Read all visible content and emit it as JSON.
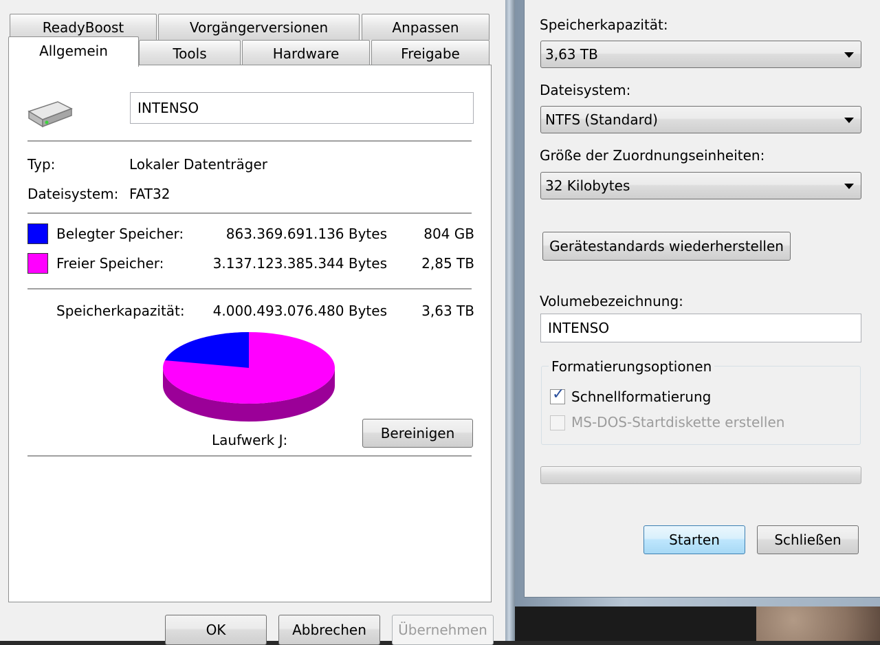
{
  "properties": {
    "tabs_row1": [
      "ReadyBoost",
      "Vorgängerversionen",
      "Anpassen"
    ],
    "tabs_row2": [
      "Allgemein",
      "Tools",
      "Hardware",
      "Freigabe"
    ],
    "active_tab": "Allgemein",
    "drive_icon": "hard-drive-icon",
    "volume_name": "INTENSO",
    "type_label": "Typ:",
    "type_value": "Lokaler Datenträger",
    "filesystem_label": "Dateisystem:",
    "filesystem_value": "FAT32",
    "used": {
      "label": "Belegter Speicher:",
      "bytes": "863.369.691.136 Bytes",
      "size": "804 GB",
      "color": "#0000ff"
    },
    "free": {
      "label": "Freier Speicher:",
      "bytes": "3.137.123.385.344 Bytes",
      "size": "2,85 TB",
      "color": "#ff00ff"
    },
    "capacity": {
      "label": "Speicherkapazität:",
      "bytes": "4.000.493.076.480 Bytes",
      "size": "3,63 TB"
    },
    "pie": {
      "used_fraction": 0.216,
      "used_color": "#0000ff",
      "free_color": "#ff00ff",
      "edge_color": "#9b0098"
    },
    "drive_label": "Laufwerk J:",
    "cleanup_button": "Bereinigen",
    "buttons": {
      "ok": "OK",
      "cancel": "Abbrechen",
      "apply": "Übernehmen"
    }
  },
  "format": {
    "capacity_label": "Speicherkapazität:",
    "capacity_value": "3,63 TB",
    "filesystem_label": "Dateisystem:",
    "filesystem_value": "NTFS (Standard)",
    "allocation_label": "Größe der Zuordnungseinheiten:",
    "allocation_value": "32 Kilobytes",
    "restore_defaults": "Gerätestandards wiederherstellen",
    "volume_label": "Volumebezeichnung:",
    "volume_value": "INTENSO",
    "options_title": "Formatierungsoptionen",
    "quick_format": {
      "label": "Schnellformatierung",
      "checked": true
    },
    "msdos_boot": {
      "label": "MS-DOS-Startdiskette erstellen",
      "checked": false,
      "disabled": true
    },
    "progress": 0,
    "start_button": "Starten",
    "close_button": "Schließen"
  }
}
